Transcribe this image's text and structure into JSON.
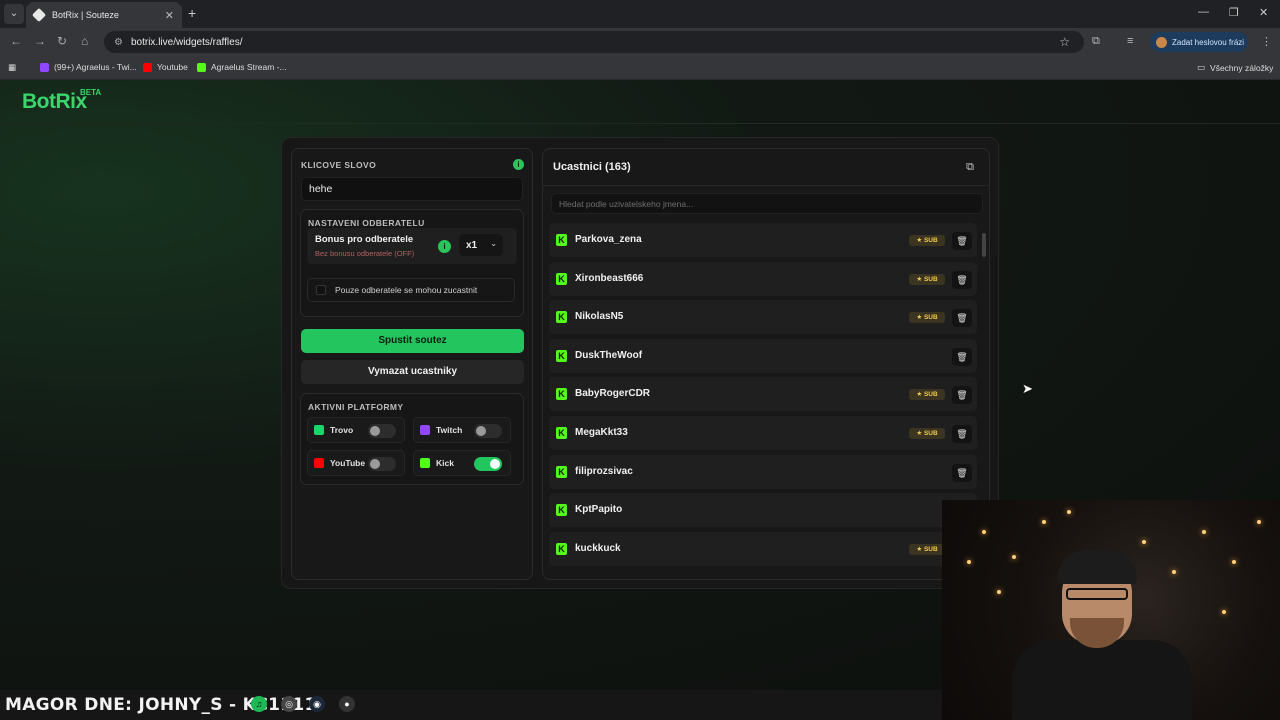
{
  "browser": {
    "tab_title": "BotRix | Souteze",
    "url": "botrix.live/widgets/raffles/",
    "profile_label": "Zadat heslovou frázi",
    "bookmarks": [
      "(99+) Agraelus - Twi...",
      "Youtube",
      "Agraelus Stream -..."
    ],
    "bookmarks_folder": "Všechny záložky"
  },
  "site": {
    "logo": "BotRix",
    "logo_badge": "BETA"
  },
  "raffle": {
    "keyword_label": "KLICOVE SLOVO",
    "keyword_value": "hehe",
    "subscriber_settings_label": "NASTAVENI ODBERATELU",
    "bonus_title": "Bonus pro odberatele",
    "bonus_subtitle": "Bez bonusu odberatele (OFF)",
    "multiplier": "x1",
    "subs_only_label": "Pouze odberatele se mohou zucastnit",
    "start_button": "Spustit soutez",
    "clear_button": "Vymazat ucastniky",
    "platforms_label": "AKTIVNI PLATFORMY",
    "platforms": [
      {
        "name": "Trovo",
        "enabled": false,
        "color": "#19d66b"
      },
      {
        "name": "Twitch",
        "enabled": false,
        "color": "#9146ff"
      },
      {
        "name": "YouTube",
        "enabled": false,
        "color": "#ff0000"
      },
      {
        "name": "Kick",
        "enabled": true,
        "color": "#53fc18"
      }
    ]
  },
  "participants": {
    "title": "Ucastnici (163)",
    "search_placeholder": "Hledat podle uzivatelskeho jmena...",
    "sub_badge": "SUB",
    "rows": [
      {
        "name": "Parkova_zena",
        "sub": true
      },
      {
        "name": "Xironbeast666",
        "sub": true
      },
      {
        "name": "NikolasN5",
        "sub": true
      },
      {
        "name": "DuskTheWoof",
        "sub": false
      },
      {
        "name": "BabyRogerCDR",
        "sub": true
      },
      {
        "name": "MegaKkt33",
        "sub": true
      },
      {
        "name": "filiprozsivac",
        "sub": false
      },
      {
        "name": "KptPapito",
        "sub": false
      },
      {
        "name": "kuckkuck",
        "sub": true
      }
    ]
  },
  "overlay": {
    "ticker": "MAGOR DNE: JOHNY_S - KC1111"
  },
  "colors": {
    "accent": "#22c55e",
    "kick": "#53fc18",
    "sub_gold": "#f2c94c"
  }
}
